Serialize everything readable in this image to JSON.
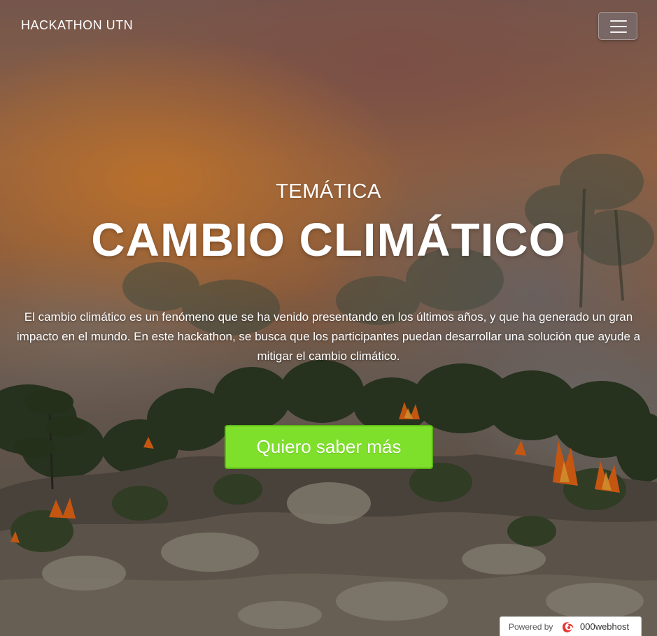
{
  "navbar": {
    "brand": "HACKATHON UTN",
    "menu_icon": "hamburger-menu-icon"
  },
  "hero": {
    "subtitle": "TEMÁTICA",
    "title": "CAMBIO CLIMÁTICO",
    "description": "El cambio climático es un fenómeno que se ha venido presentando en los últimos años, y que ha generado un gran impacto en el mundo. En este hackathon, se busca que los participantes puedan desarrollar una solución que ayude a mitigar el cambio climático.",
    "cta_label": "Quiero saber más",
    "background_image": "forest-fire-photo"
  },
  "footer_badge": {
    "powered_label": "Powered by",
    "host_label": "000webhost",
    "logo_icon": "000webhost-logo-icon"
  },
  "colors": {
    "cta_background": "#7ee02a",
    "cta_border": "#5fb718",
    "text": "#ffffff"
  }
}
